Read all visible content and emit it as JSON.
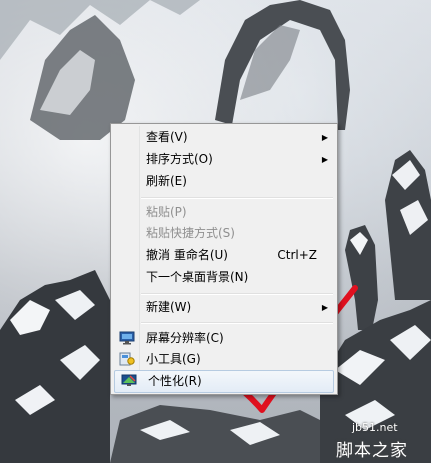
{
  "context_menu": {
    "items": [
      {
        "label": "查看(V)",
        "submenu": true
      },
      {
        "label": "排序方式(O)",
        "submenu": true
      },
      {
        "label": "刷新(E)"
      },
      {
        "label": "粘贴(P)",
        "disabled": true
      },
      {
        "label": "粘贴快捷方式(S)",
        "disabled": true
      },
      {
        "label": "撤消 重命名(U)",
        "shortcut": "Ctrl+Z"
      },
      {
        "label": "下一个桌面背景(N)"
      },
      {
        "label": "新建(W)",
        "submenu": true
      },
      {
        "label": "屏幕分辨率(C)",
        "icon": "screen-resolution-icon"
      },
      {
        "label": "小工具(G)",
        "icon": "gadgets-icon"
      },
      {
        "label": "个性化(R)",
        "icon": "personalize-icon",
        "highlighted": true
      }
    ]
  },
  "watermark": {
    "site": "jb51.net",
    "name": "脚本之家"
  },
  "colors": {
    "checkmark": "#e0101f",
    "menu_bg": "#f0f0f0",
    "highlight_border": "#b6cbe1"
  }
}
